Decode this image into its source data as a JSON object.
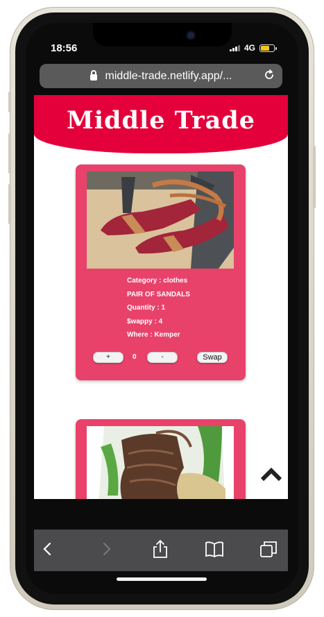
{
  "status_bar": {
    "time": "18:56",
    "network": "4G"
  },
  "browser": {
    "url": "middle-trade.netlify.app/..."
  },
  "site": {
    "title": "Middle Trade"
  },
  "items": [
    {
      "category": "Category : clothes",
      "name": "PAIR OF SANDALS",
      "quantity": "Quantity : 1",
      "swappy": "$wappy : 4",
      "where": "Where : Kemper",
      "plus_label": "+",
      "count": "0",
      "minus_label": "-",
      "swap_label": "Swap"
    }
  ],
  "icons": {
    "lock": "lock-icon",
    "reload": "reload-icon",
    "scroll_top": "chevron-up-icon",
    "profile": "person-silhouette-icon",
    "basket": "basket-icon",
    "back": "back-arrow-icon",
    "forward": "forward-arrow-icon",
    "share": "share-icon",
    "bookmarks": "book-icon",
    "tabs": "tabs-icon"
  },
  "colors": {
    "brand": "#e4003a",
    "card": "#e8426b",
    "toolbar": "#4b4b4d",
    "url_bar": "#5a5a5a"
  }
}
